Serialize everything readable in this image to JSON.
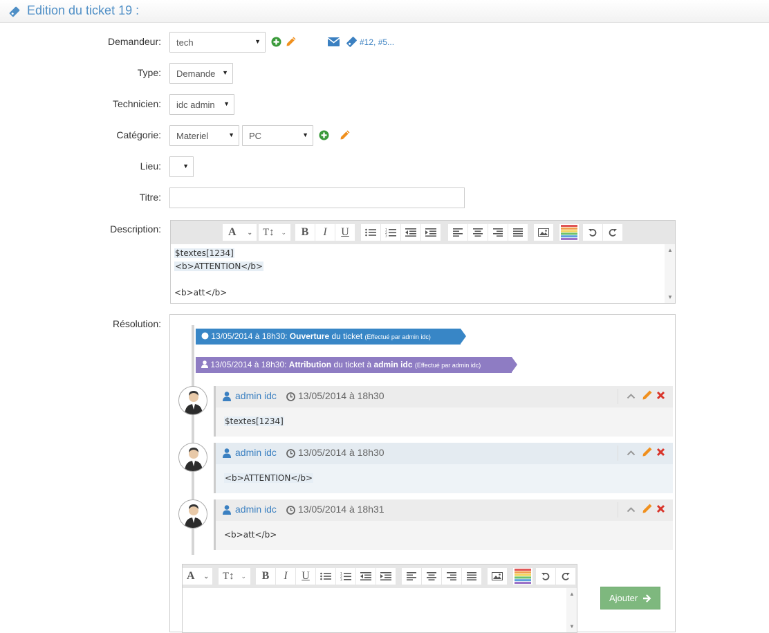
{
  "header": {
    "title": "Edition du ticket 19 :"
  },
  "form": {
    "demandeur": {
      "label": "Demandeur:",
      "value": "tech",
      "ticket_links": "#12, #5..."
    },
    "type": {
      "label": "Type:",
      "value": "Demande"
    },
    "technicien": {
      "label": "Technicien:",
      "value": "idc admin"
    },
    "categorie": {
      "label": "Catégorie:",
      "value": "Materiel",
      "sub_value": "PC"
    },
    "lieu": {
      "label": "Lieu:",
      "value": ""
    },
    "titre": {
      "label": "Titre:",
      "value": ""
    },
    "description": {
      "label": "Description:",
      "lines": [
        "$textes[1234]",
        "<b>ATTENTION</b>",
        "",
        "<b>att</b>"
      ]
    },
    "resolution": {
      "label": "Résolution:"
    }
  },
  "toolbar": {
    "font": "A",
    "size": "T↕",
    "bold": "B",
    "italic": "I",
    "underline": "U"
  },
  "timeline": {
    "events": [
      {
        "date": "13/05/2014 à 18h30:",
        "action": "Ouverture",
        "rest": " du ticket ",
        "meta": "(Effectué par admin idc)"
      },
      {
        "date": "13/05/2014 à 18h30:",
        "action": "Attribution",
        "rest": " du ticket à ",
        "target": "admin idc",
        "meta": "(Effectué par admin idc)"
      }
    ],
    "messages": [
      {
        "author": "admin idc",
        "date": "13/05/2014 à 18h30",
        "text": "$textes[1234]"
      },
      {
        "author": "admin idc",
        "date": "13/05/2014 à 18h30",
        "text": "<b>ATTENTION</b>"
      },
      {
        "author": "admin idc",
        "date": "13/05/2014 à 18h31",
        "text": "<b>att</b>"
      }
    ]
  },
  "actions": {
    "submit": "Ajouter"
  },
  "colors": {
    "link": "#3b80c1",
    "add_green": "#3a9a3a",
    "edit_orange": "#f0901e",
    "delete_red": "#d9352b",
    "submit": "#7eb87e"
  }
}
